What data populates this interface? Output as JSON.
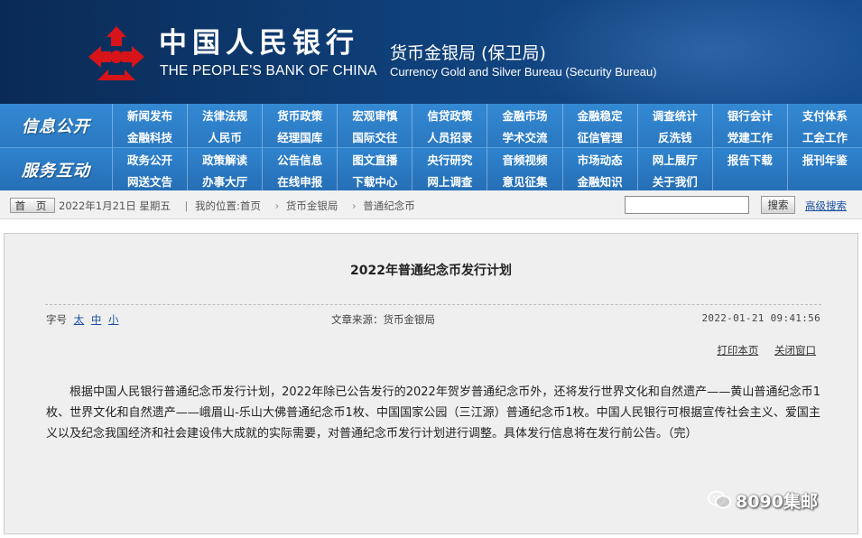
{
  "header": {
    "bank_name_cn": "中国人民银行",
    "bank_name_en": "THE PEOPLE'S BANK OF CHINA",
    "bureau_cn": "货币金银局 (保卫局)",
    "bureau_en": "Currency  Gold and Silver Bureau (Security Bureau)",
    "logo_icon": "pboc-emblem-icon",
    "brand_color": "#0f3f78",
    "emblem_color": "#d7141a"
  },
  "nav": {
    "groups": [
      {
        "label": "信息公开",
        "items": [
          "新闻发布",
          "法律法规",
          "货币政策",
          "宏观审慎",
          "信贷政策",
          "金融市场",
          "金融稳定",
          "调查统计",
          "银行会计",
          "支付体系",
          "金融科技",
          "人民币",
          "经理国库",
          "国际交往",
          "人员招录",
          "学术交流",
          "征信管理",
          "反洗钱",
          "党建工作",
          "工会工作"
        ]
      },
      {
        "label": "服务互动",
        "items": [
          "政务公开",
          "政策解读",
          "公告信息",
          "图文直播",
          "央行研究",
          "音频视频",
          "市场动态",
          "网上展厅",
          "报告下载",
          "报刊年鉴",
          "网送文告",
          "办事大厅",
          "在线申报",
          "下载中心",
          "网上调查",
          "意见征集",
          "金融知识",
          "关于我们",
          "",
          ""
        ]
      }
    ],
    "color": "#2a79c2"
  },
  "crumbbar": {
    "home_label": "首 页",
    "date": "2022年1月21日 星期五",
    "location_label": "我的位置:首页",
    "crumbs": [
      "货币金银局",
      "普通纪念币"
    ],
    "search_value": "",
    "search_button": "搜索",
    "advanced_search": "高级搜索"
  },
  "article": {
    "title": "2022年普通纪念币发行计划",
    "font_size_label": "字号",
    "font_sizes": [
      "太",
      "中",
      "小"
    ],
    "source": "文章来源：货币金银局",
    "datetime": "2022-01-21 09:41:56",
    "print_label": "打印本页",
    "close_label": "关闭窗口",
    "body": "根据中国人民银行普通纪念币发行计划，2022年除已公告发行的2022年贺岁普通纪念币外，还将发行世界文化和自然遗产——黄山普通纪念币1枚、世界文化和自然遗产——峨眉山-乐山大佛普通纪念币1枚、中国国家公园（三江源）普通纪念币1枚。中国人民银行可根据宣传社会主义、爱国主义以及纪念我国经济和社会建设伟大成就的实际需要，对普通纪念币发行计划进行调整。具体发行信息将在发行前公告。（完）"
  },
  "watermark": {
    "icon": "wechat-icon",
    "text": "8090集邮"
  }
}
